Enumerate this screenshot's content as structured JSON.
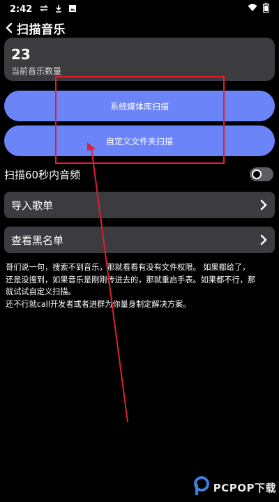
{
  "status_bar": {
    "time": "2:42",
    "icons": [
      "sync-icon",
      "download-icon",
      "image-icon",
      "wifi-icon",
      "battery-icon"
    ]
  },
  "header": {
    "back_icon": "chevron-left-icon",
    "title": "扫描音乐"
  },
  "music_count": {
    "value": "23",
    "label": "当前音乐数量"
  },
  "scan_buttons": {
    "system": "系统媒体库扫描",
    "custom": "自定义文件夹扫描"
  },
  "settings": {
    "scan_short_label": "扫描60秒内音频",
    "scan_short_enabled": false
  },
  "menu": {
    "import_label": "导入歌单",
    "blacklist_label": "查看黑名单",
    "chevron_icon": "chevron-right-icon"
  },
  "help": {
    "lines": [
      "哥们说一句，搜索不到音乐，那就看看有没有文件权限。 如果都给了，",
      "还是没搜到，如果音乐是刚刚传进去的，那就重启手表。如果都不行，那",
      "就试试自定义扫描。",
      "还不行就call开发者或者进群为你量身制定解决方案。"
    ]
  },
  "colors": {
    "background": "#000000",
    "card": "#3c3c40",
    "accent_button": "#6b84f7",
    "annotation": "#e0202a"
  },
  "watermark": {
    "text": "PCPOP下载"
  }
}
